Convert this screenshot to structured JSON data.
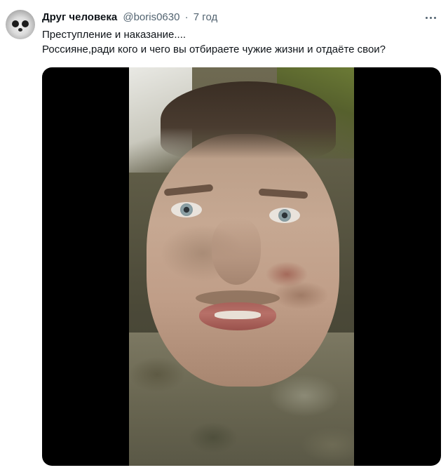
{
  "tweet": {
    "author": {
      "display_name": "Друг человека",
      "handle": "@boris0630"
    },
    "separator": "·",
    "time": "7 год",
    "text_lines": [
      "Преступление и наказание....",
      "Россияне,ради кого и чего  вы отбираете чужие жизни и отдаёте свои?"
    ]
  },
  "icons": {
    "more": "more-horizontal-icon",
    "avatar": "lemur-avatar"
  }
}
